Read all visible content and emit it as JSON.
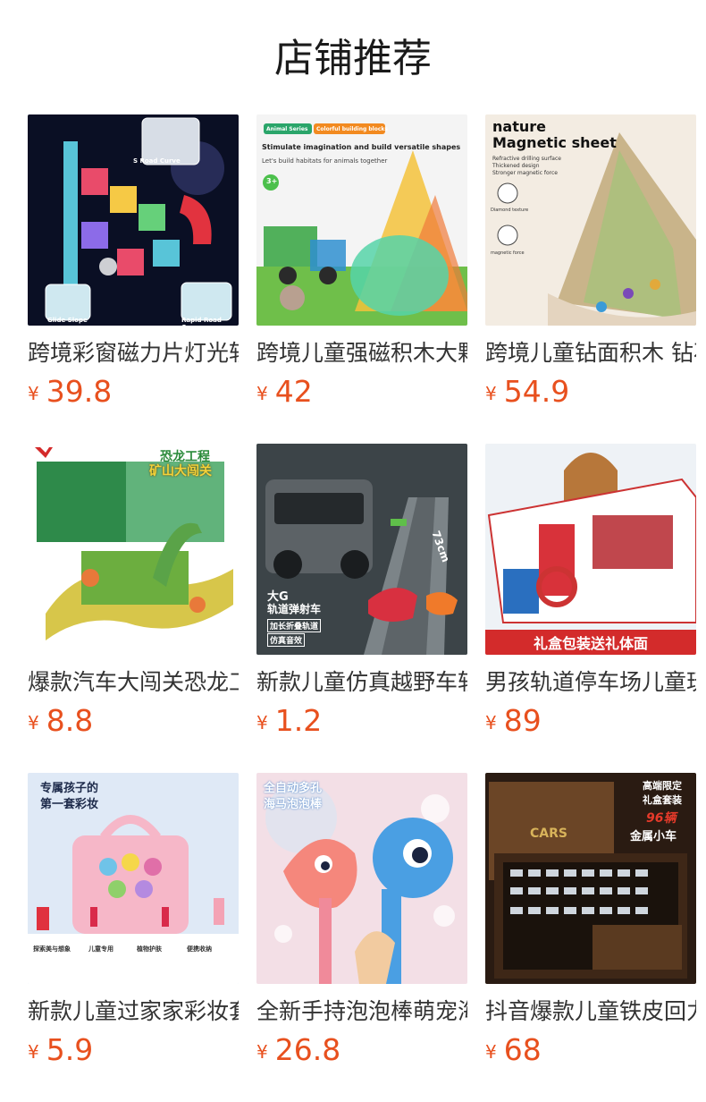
{
  "header": {
    "title": "店铺推荐"
  },
  "currency": "¥",
  "products": [
    {
      "name": "跨境彩窗磁力片灯光轨道",
      "price": "39.8",
      "image_labels": [
        "S Road Curve",
        "Glide Slope",
        "Rapid Road Curve"
      ]
    },
    {
      "name": "跨境儿童强磁积木大颗粒",
      "price": "42",
      "image_labels": [
        "Animal Series",
        "Colorful building blocks",
        "Stimulate imagination and build versatile shapes",
        "Let's build habitats for animals together",
        "3+"
      ]
    },
    {
      "name": "跨境儿童钻面积木 钻石磁力片",
      "price": "54.9",
      "image_labels": [
        "nature",
        "Magnetic sheet",
        "Refractive drilling surface",
        "Thickened design",
        "Stronger magnetic force",
        "Diamond texture",
        "magnetic force"
      ]
    },
    {
      "name": "爆款汽车大闯关恐龙工程",
      "price": "8.8",
      "image_labels": [
        "恐龙工程",
        "矿山大闯关"
      ]
    },
    {
      "name": "新款儿童仿真越野车轨道",
      "price": "1.2",
      "image_labels": [
        "大G",
        "轨道弹射车",
        "加长折叠轨道",
        "仿真音效",
        "73cm"
      ]
    },
    {
      "name": "男孩轨道停车场儿童玩具",
      "price": "89",
      "image_labels": [
        "礼盒包装送礼体面"
      ]
    },
    {
      "name": "新款儿童过家家彩妆套装",
      "price": "5.9",
      "image_labels": [
        "专属孩子的",
        "第一套彩妆",
        "探索美与想象",
        "儿童专用",
        "植物护肤",
        "便携收纳"
      ]
    },
    {
      "name": "全新手持泡泡棒萌宠海马",
      "price": "26.8",
      "image_labels": [
        "全自动多孔",
        "海马泡泡棒"
      ]
    },
    {
      "name": "抖音爆款儿童铁皮回力车",
      "price": "68",
      "image_labels": [
        "高端限定",
        "礼盒套装",
        "96辆",
        "金属小车",
        "CARS"
      ]
    }
  ],
  "colors": {
    "price": "#e8501e",
    "title": "#1a1a1a",
    "name": "#333333"
  }
}
